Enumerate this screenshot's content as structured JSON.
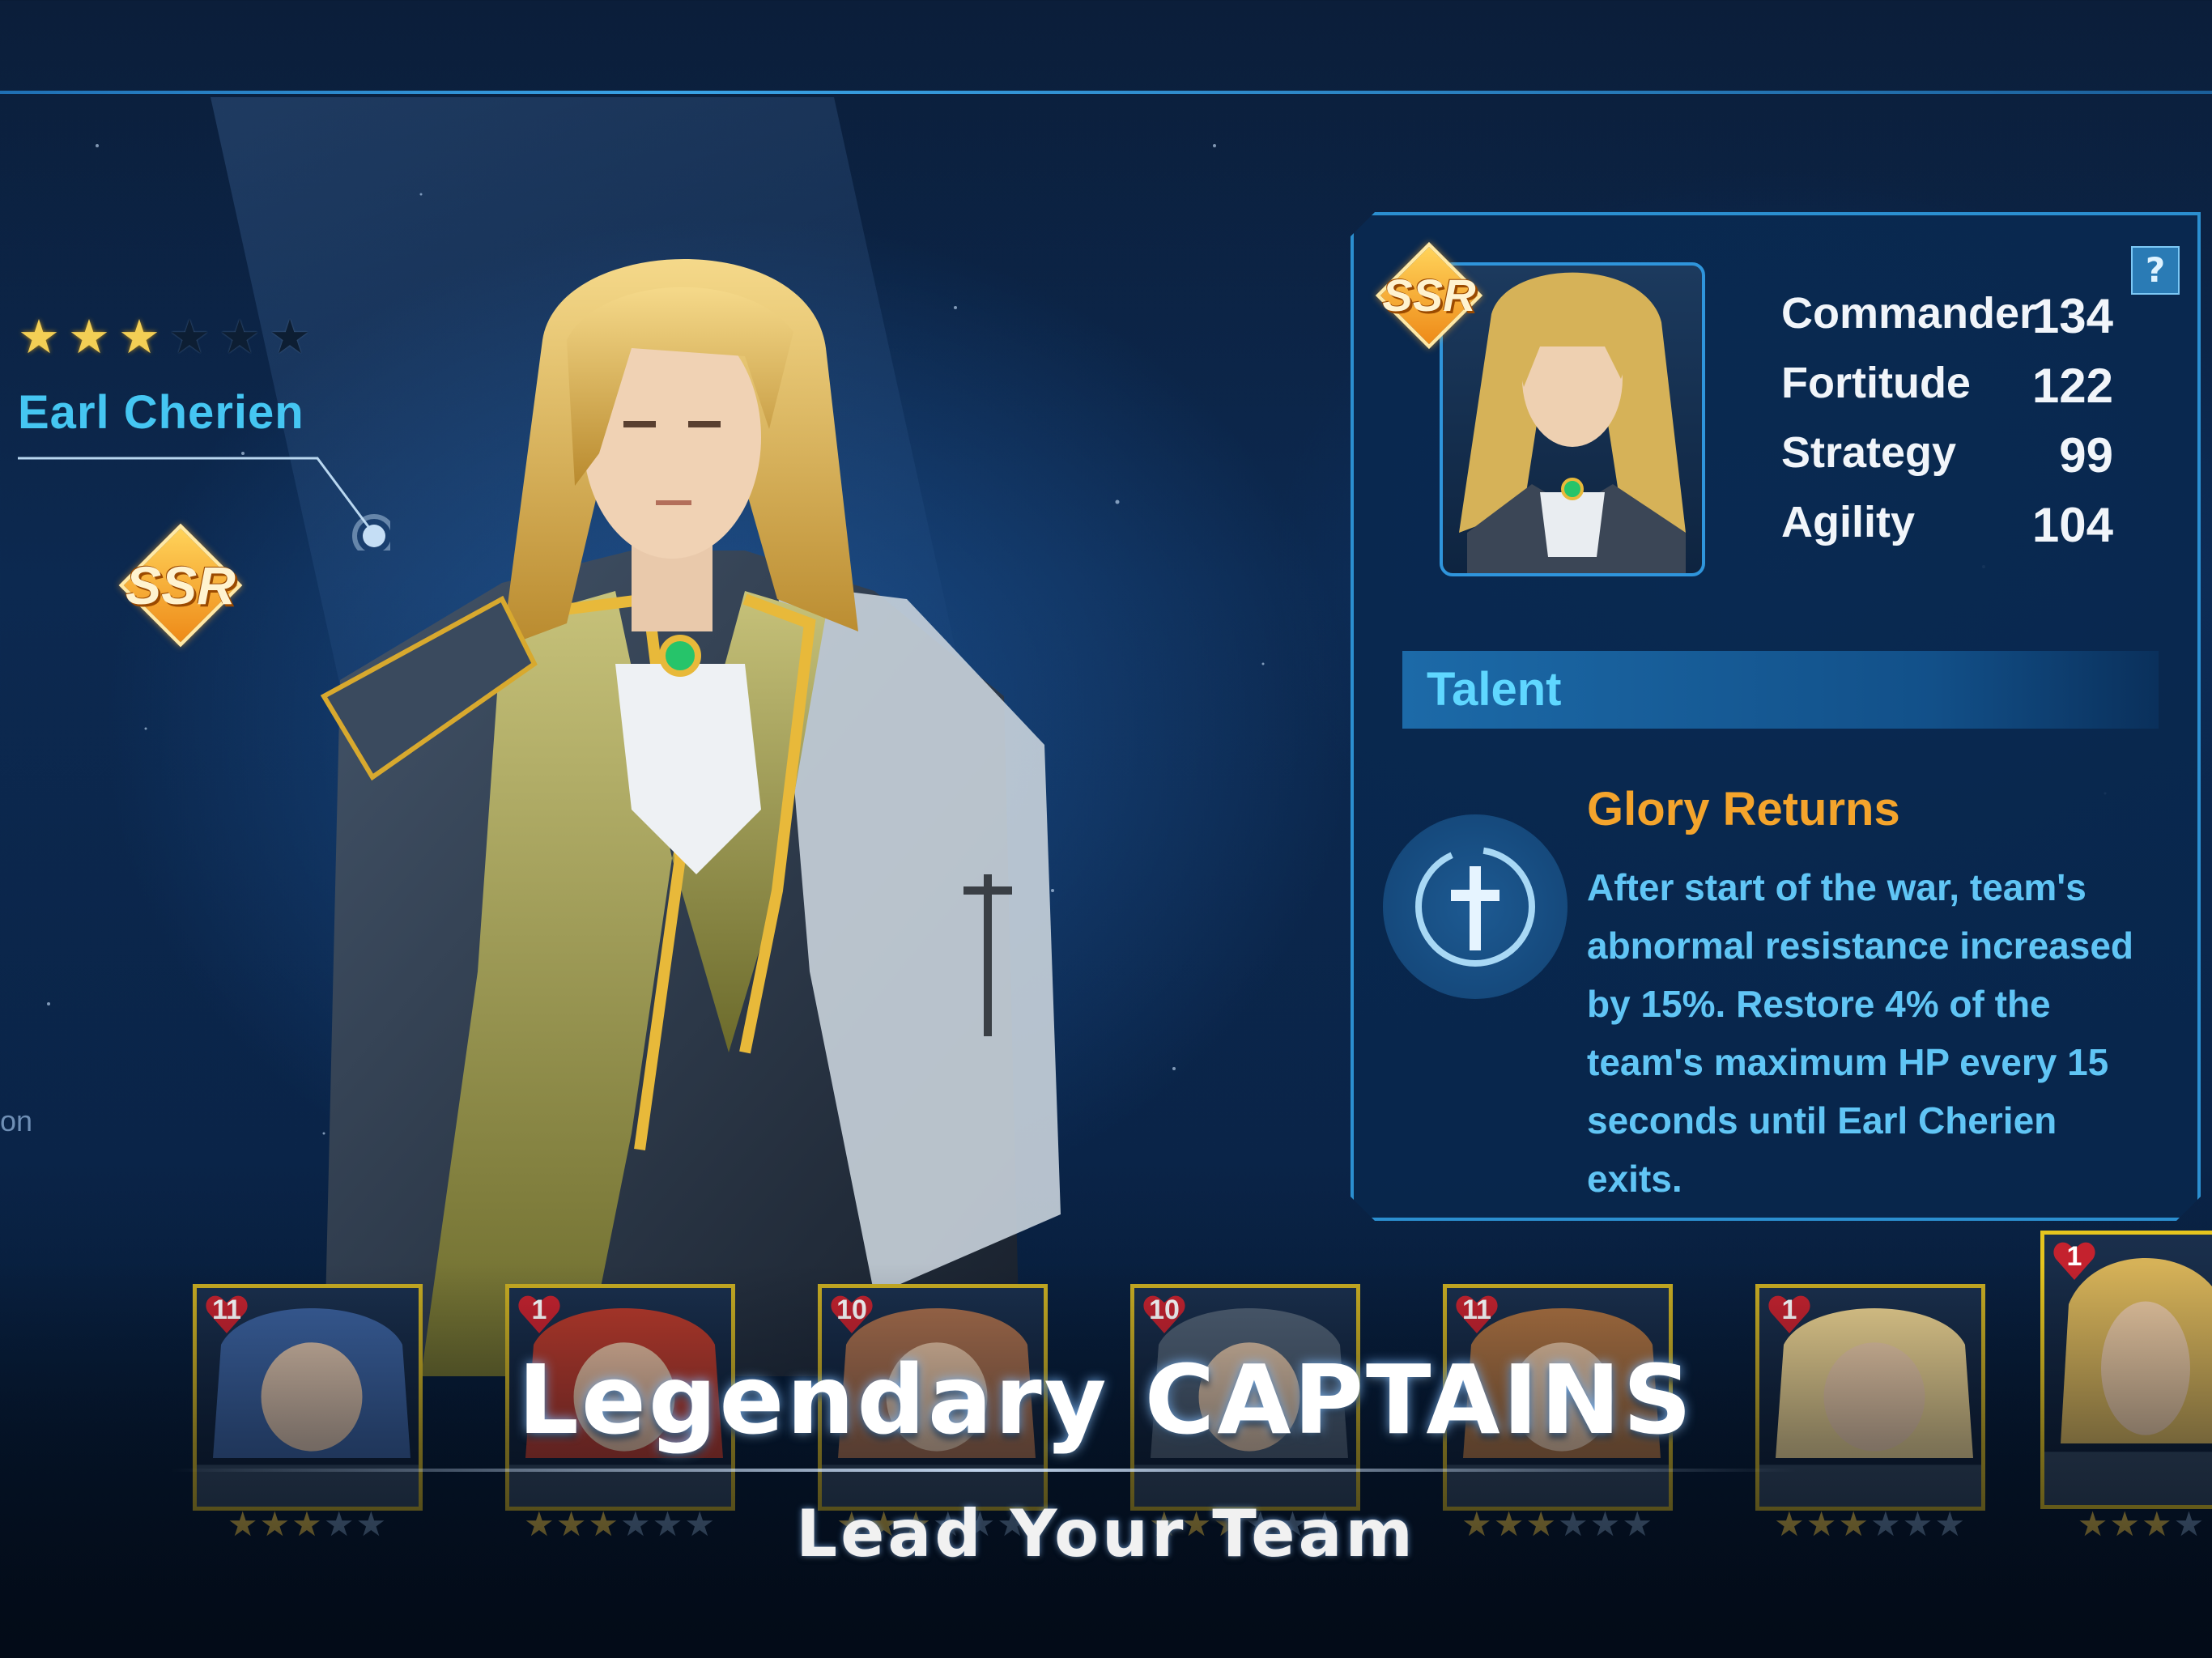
{
  "hero": {
    "name": "Earl Cherien",
    "rarity": "SSR",
    "stars_filled": 3,
    "stars_total": 6
  },
  "stats": [
    {
      "label": "Commander",
      "value": "134"
    },
    {
      "label": "Fortitude",
      "value": "122"
    },
    {
      "label": "Strategy",
      "value": "99"
    },
    {
      "label": "Agility",
      "value": "104"
    }
  ],
  "panel": {
    "help_label": "?",
    "talent_header": "Talent",
    "skill_name": "Glory Returns",
    "skill_description": "After start of the war, team's abnormal resistance increased by 15%. Restore 4% of the team's maximum HP every 15 seconds until Earl Cherien exits."
  },
  "roster": [
    {
      "level": "11",
      "stars_filled": 3,
      "stars_total": 5
    },
    {
      "level": "1",
      "stars_filled": 3,
      "stars_total": 6
    },
    {
      "level": "10",
      "stars_filled": 3,
      "stars_total": 6
    },
    {
      "level": "10",
      "stars_filled": 3,
      "stars_total": 6
    },
    {
      "level": "11",
      "stars_filled": 3,
      "stars_total": 6
    },
    {
      "level": "1",
      "stars_filled": 3,
      "stars_total": 6
    },
    {
      "level": "1",
      "stars_filled": 3,
      "stars_total": 4
    }
  ],
  "side_text": "on",
  "tagline": {
    "main": "Legendary CAPTAINS",
    "sub": "Lead Your Team"
  },
  "colors": {
    "accent_blue": "#2b8fd0",
    "name_cyan": "#45c6f2",
    "skill_orange": "#f4a42c",
    "card_gold": "#c9ad22"
  },
  "icons": [
    "star-icon",
    "ssr-badge-icon",
    "help-icon",
    "talent-cross-icon",
    "heart-level-icon"
  ]
}
